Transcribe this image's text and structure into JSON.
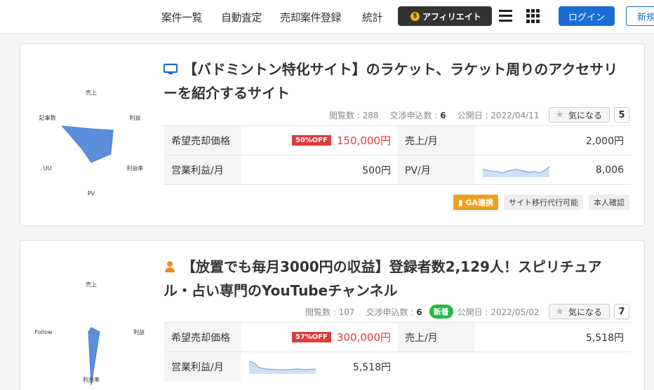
{
  "header": {
    "nav": [
      "案件一覧",
      "自動査定",
      "売却案件登録",
      "統計"
    ],
    "affiliate_label": "アフィリエイト",
    "login_label": "ログイン",
    "register_label": "新規"
  },
  "listings": [
    {
      "title": "【バドミントン特化サイト】のラケット、ラケット周りのアクセサリーを紹介するサイト",
      "icon": "monitor-icon",
      "meta": {
        "views_label": "閲覧数 : 288",
        "nego_label": "交渉申込数 : ",
        "nego_value": "6",
        "published": "公開日 : 2022/04/11"
      },
      "fav_label": "気になる",
      "fav_count": "5",
      "radar": {
        "axes": [
          "売上",
          "利益",
          "利益率",
          "PV",
          "UU",
          "記事数"
        ],
        "levels": [
          0.25,
          0.45,
          0.4,
          0.35,
          0.2,
          0.6
        ]
      },
      "rows": [
        {
          "l1": "希望売却価格",
          "badge": "50%OFF",
          "v1": "150,000円",
          "l2": "売上/月",
          "v2": "2,000円"
        },
        {
          "l1": "営業利益/月",
          "v1": "500円",
          "l2": "PV/月",
          "v2": "8,006"
        }
      ],
      "tags": [
        "GA連携",
        "サイト移行代行可能",
        "本人確認"
      ]
    },
    {
      "title": "【放置でも毎月3000円の収益】登録者数2,129人！スピリチュアル・占い専門のYouTubeチャンネル",
      "icon": "person-icon",
      "meta": {
        "views_label": "閲覧数 : 107",
        "nego_label": "交渉申込数 : ",
        "nego_value": "6",
        "new_badge": "新着",
        "published": "公開日 : 2022/05/02"
      },
      "fav_label": "気になる",
      "fav_count": "7",
      "radar": {
        "axes": [
          "売上",
          "利益",
          "利益率",
          "Follow"
        ],
        "levels": [
          0.08,
          0.15,
          0.95,
          0.05
        ]
      },
      "rows": [
        {
          "l1": "希望売却価格",
          "badge": "57%OFF",
          "v1": "300,000円",
          "l2": "売上/月",
          "v2": "5,518円"
        },
        {
          "l1": "営業利益/月",
          "v1": "5,518円"
        }
      ]
    }
  ],
  "colors": {
    "accent": "#1a6ed6",
    "price_red": "#e03a3a",
    "radar_fill": "#5b8fdc",
    "ga_tag": "#f0a020",
    "new_badge": "#25b845"
  }
}
